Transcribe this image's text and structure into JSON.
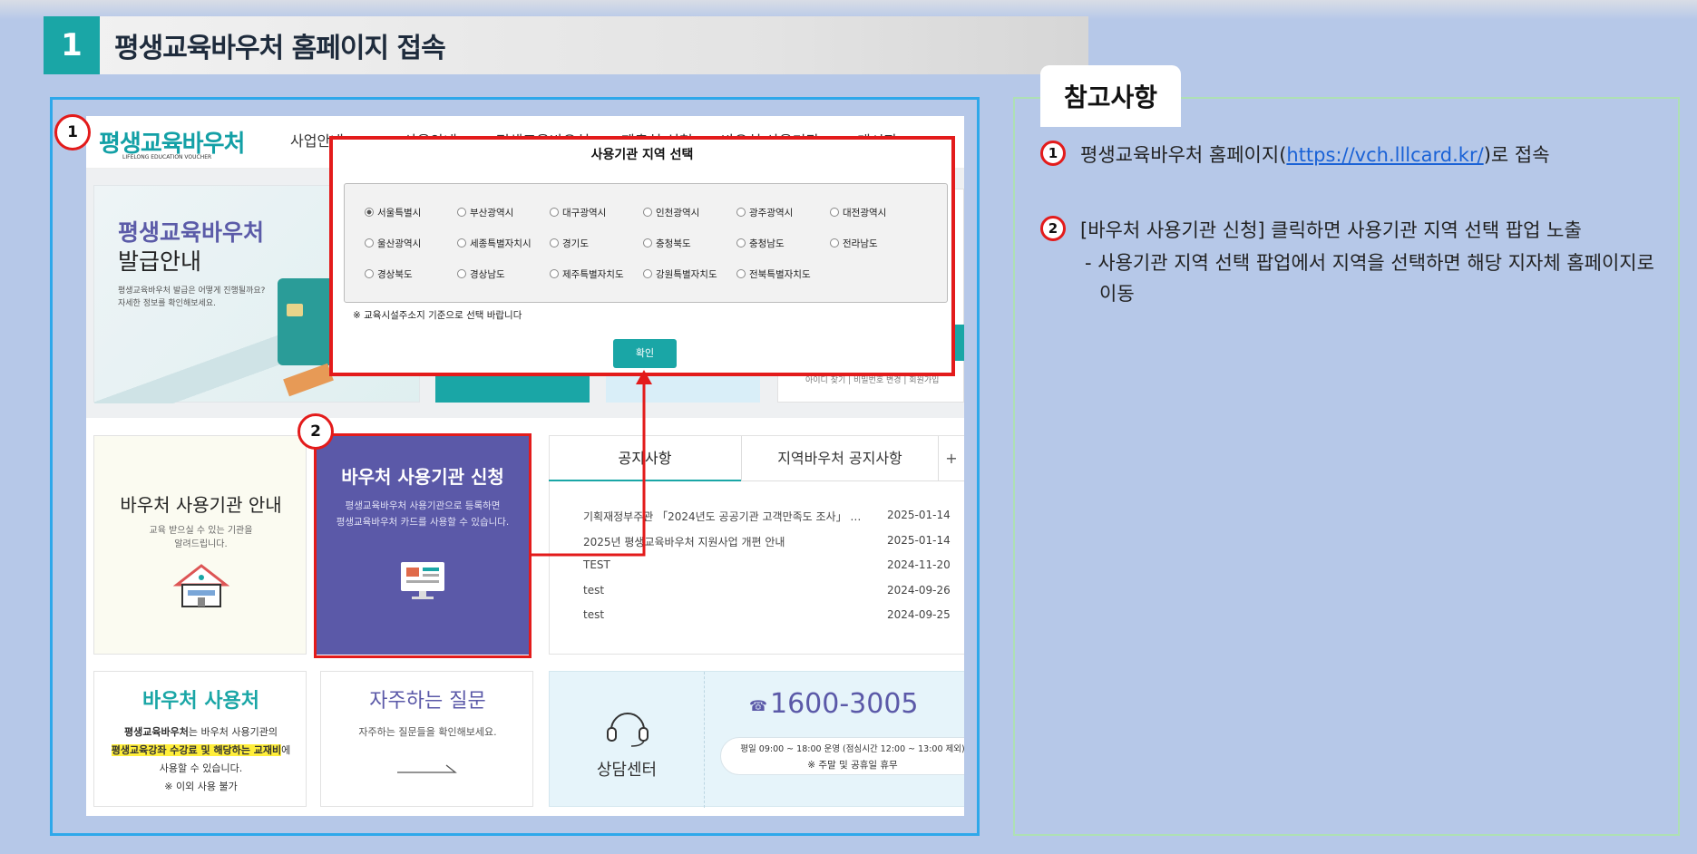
{
  "step": {
    "number": "1",
    "title": "평생교육바우처 홈페이지 접속"
  },
  "site": {
    "logo": "평생교육바우처",
    "logo_sub": "LIFELONG EDUCATION VOUCHER",
    "nav": [
      "사업안내",
      "사용안내",
      "평생교육바우처",
      "제출처 신청",
      "바우처 사용기관",
      "게시판"
    ],
    "banner": {
      "title1": "평생교육바우처",
      "title2": "발급안내",
      "desc1": "평생교육바우처 발급은 어떻게 진행될까요?",
      "desc2": "자세한 정보를 확인해보세요."
    },
    "login_links": "아이디 찾기 | 비밀번호 변경 | 회원가입",
    "card_institution": {
      "title": "바우처 사용기관 안내",
      "desc1": "교육 받으실 수 있는 기관을",
      "desc2": "알려드립니다."
    },
    "card_apply": {
      "title": "바우처 사용기관 신청",
      "desc1": "평생교육바우처 사용기관으로 등록하면",
      "desc2": "평생교육바우처 카드를 사용할 수 있습니다."
    },
    "tabs": [
      "공지사항",
      "지역바우처 공지사항"
    ],
    "tab_more": "+",
    "notices": [
      {
        "title": "기획재정부주관 「2024년도 공공기관 고객만족도 조사」 …",
        "date": "2025-01-14"
      },
      {
        "title": "2025년 평생교육바우처 지원사업 개편 안내",
        "date": "2025-01-14"
      },
      {
        "title": "TEST",
        "date": "2024-11-20"
      },
      {
        "title": "test",
        "date": "2024-09-26"
      },
      {
        "title": "test",
        "date": "2024-09-25"
      }
    ],
    "card_use": {
      "title": "바우처 사용처",
      "line1_bold": "평생교육바우처",
      "line1_rest": "는 바우처 사용기관의",
      "line2_highlight": "평생교육강좌 수강료 및 해당하는 교재비",
      "line2_rest": "에",
      "line3": "사용할 수 있습니다.",
      "line4": "※ 이외 사용 불가"
    },
    "card_faq": {
      "title": "자주하는 질문",
      "desc": "자주하는 질문들을 확인해보세요."
    },
    "call": {
      "label": "상담센터",
      "phone": "1600-3005",
      "hours": "평일 09:00 ~ 18:00 운영 (점심시간 12:00 ~ 13:00 제외)",
      "holiday": "※ 주말 및 공휴일 휴무"
    }
  },
  "popup": {
    "title": "사용기관 지역 선택",
    "regions": [
      [
        "서울특별시",
        "부산광역시",
        "대구광역시",
        "인천광역시",
        "광주광역시",
        "대전광역시"
      ],
      [
        "울산광역시",
        "세종특별자치시",
        "경기도",
        "충청북도",
        "충청남도",
        "전라남도"
      ],
      [
        "경상북도",
        "경상남도",
        "제주특별자치도",
        "강원특별자치도",
        "전북특별자치도"
      ]
    ],
    "selected": "서울특별시",
    "note": "※ 교육시설주소지 기준으로 선택 바랍니다",
    "confirm": "확인"
  },
  "markers": [
    "1",
    "2"
  ],
  "reference": {
    "tab": "참고사항",
    "item1_num": "1",
    "item1_before": "평생교육바우처 홈페이지(",
    "item1_link": "https://vch.lllcard.kr/",
    "item1_after": ")로 접속",
    "item2_num": "2",
    "item2_line1": "[바우처 사용기관 신청] 클릭하면 사용기관 지역 선택 팝업 노출",
    "item2_line2": "- 사용기관 지역 선택 팝업에서 지역을 선택하면 해당 지자체 홈페이지로",
    "item2_line3": "이동"
  },
  "colors": {
    "accent": "#1aa6a6",
    "highlight_red": "#e31b1b",
    "apply_card": "#5b59a8",
    "frame_blue": "#2ea8ea",
    "background": "#b6c8e8"
  }
}
